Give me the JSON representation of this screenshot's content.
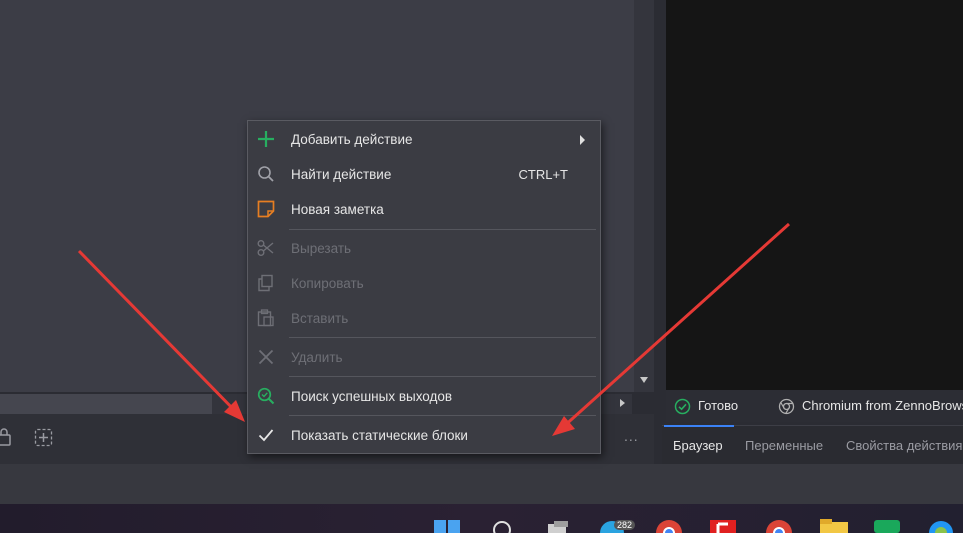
{
  "context_menu": {
    "items": [
      {
        "label": "Добавить действие",
        "icon": "plus-icon",
        "has_submenu": true,
        "disabled": false
      },
      {
        "label": "Найти действие",
        "icon": "search-icon",
        "shortcut": "CTRL+T",
        "disabled": false
      },
      {
        "label": "Новая заметка",
        "icon": "note-icon",
        "disabled": false
      },
      {
        "label": "Вырезать",
        "icon": "scissors-icon",
        "disabled": true
      },
      {
        "label": "Копировать",
        "icon": "copy-icon",
        "disabled": true
      },
      {
        "label": "Вставить",
        "icon": "paste-icon",
        "disabled": true
      },
      {
        "label": "Удалить",
        "icon": "close-icon",
        "disabled": true
      },
      {
        "label": "Поиск успешных выходов",
        "icon": "zoom-search-icon",
        "disabled": false
      },
      {
        "label": "Показать статические блоки",
        "icon": "check-icon",
        "checked": true,
        "disabled": false
      }
    ]
  },
  "status_bar": {
    "status": "Готово",
    "browser": "Chromium from ZennoBrowser"
  },
  "panel_tabs": [
    "Браузер",
    "Переменные",
    "Свойства действия"
  ],
  "more_label": "...",
  "taskbar": {
    "badge_count": "282"
  },
  "colors": {
    "accent_green": "#27ae60",
    "note_orange": "#e67e22",
    "tab_underline": "#3b82f6",
    "arrow_red": "#e53935"
  }
}
